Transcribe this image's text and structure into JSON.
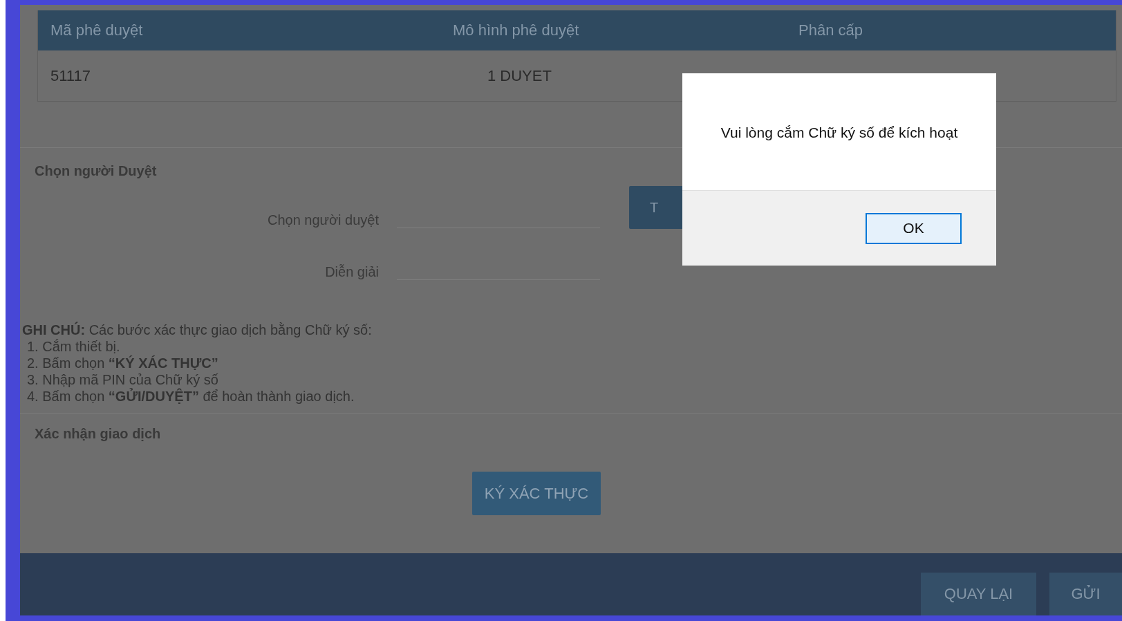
{
  "table": {
    "columns": [
      "Mã phê duyệt",
      "Mô hình phê duyệt",
      "Phân cấp"
    ],
    "rows": [
      {
        "cells": [
          "51117",
          "1 DUYET"
        ]
      }
    ]
  },
  "approver_section": {
    "title": "Chọn người Duyệt",
    "fields": [
      {
        "label": "Chọn người duyệt"
      },
      {
        "label": "Diễn giải"
      }
    ],
    "button": "T"
  },
  "notes": [
    "**GHI CHÚ:** Các bước xác thực giao dịch bằng Chữ ký số:",
    "1. Cắm thiết bị.",
    "2. Bấm chọn **“KÝ XÁC THỰC”**",
    "3. Nhập mã PIN của Chữ ký số",
    "4. Bấm chọn **“GỬI/DUYỆT”** để hoàn thành giao dịch."
  ],
  "confirm_section": {
    "title": "Xác nhận giao dịch",
    "button": "KÝ XÁC THỰC"
  },
  "footer": {
    "buttons": [
      "QUAY LẠI",
      "GỬI"
    ]
  },
  "dialog": {
    "message": "Vui lòng cắm Chữ ký  số để kích hoạt",
    "button": "OK"
  }
}
